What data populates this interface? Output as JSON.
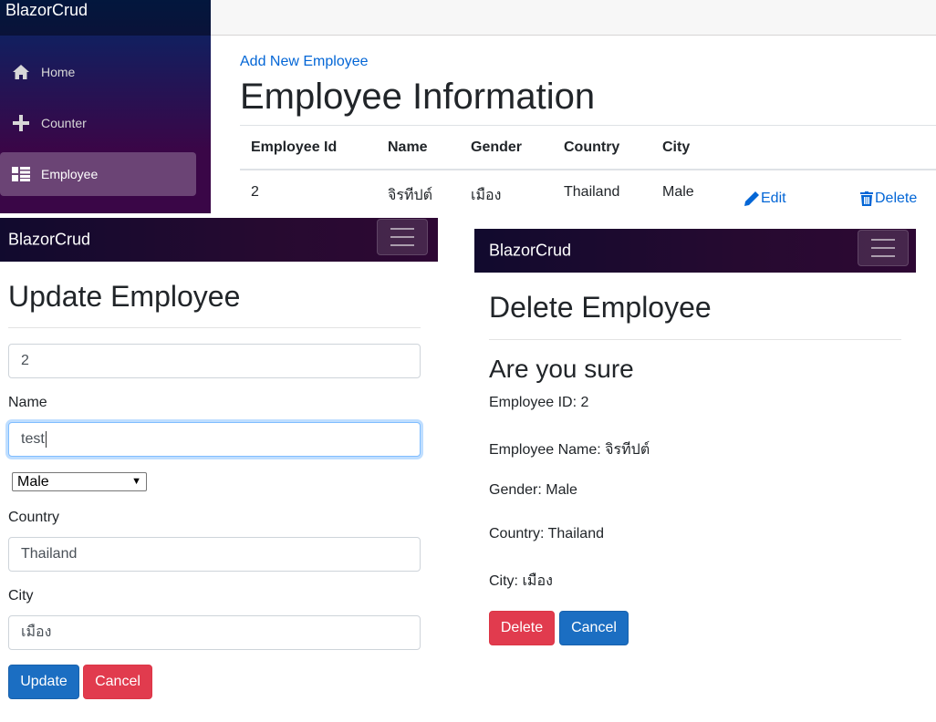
{
  "list_page": {
    "brand": "BlazorCrud",
    "nav": [
      {
        "label": "Home",
        "icon": "home-icon"
      },
      {
        "label": "Counter",
        "icon": "plus-icon"
      },
      {
        "label": "Employee",
        "icon": "list-icon",
        "active": true
      }
    ],
    "add_link": "Add New Employee",
    "title": "Employee Information",
    "table": {
      "headers": [
        "Employee Id",
        "Name",
        "Gender",
        "Country",
        "City"
      ],
      "rows": [
        {
          "id": "2",
          "name": "จิรทีปต์",
          "gender": "เมือง",
          "country": "Thailand",
          "city": "Male"
        }
      ],
      "edit_label": "Edit",
      "delete_label": "Delete"
    }
  },
  "update_page": {
    "brand": "BlazorCrud",
    "title": "Update Employee",
    "id_value": "2",
    "name_label": "Name",
    "name_value": "test",
    "gender_selected": "Male",
    "country_label": "Country",
    "country_value": "Thailand",
    "city_label": "City",
    "city_value": "เมือง",
    "update_button": "Update",
    "cancel_button": "Cancel"
  },
  "delete_page": {
    "brand": "BlazorCrud",
    "title": "Delete Employee",
    "confirm_heading": "Are you sure",
    "lines": [
      "Employee ID: 2",
      "Employee Name: จิรทีปต์",
      "Gender: Male",
      "Country: Thailand",
      "City: เมือง"
    ],
    "delete_button": "Delete",
    "cancel_button": "Cancel"
  },
  "colors": {
    "link": "#0366d6",
    "primary": "#1b6ec2",
    "danger": "#e13b4e",
    "sidebar_top": "#052767",
    "sidebar_bottom": "#3a0647"
  }
}
